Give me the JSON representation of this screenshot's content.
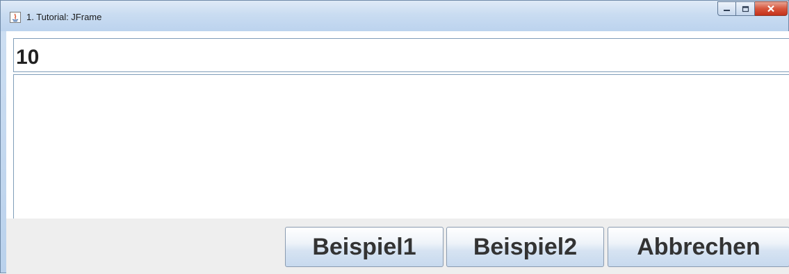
{
  "window": {
    "title": "1. Tutorial: JFrame",
    "app_icon": "java-icon",
    "caption_icons": [
      "minimize-icon",
      "maximize-icon",
      "close-icon"
    ],
    "close_color": "#c4311a"
  },
  "main": {
    "number_field_value": "10",
    "text_area_value": ""
  },
  "buttons": {
    "example1_label": "Beispiel1",
    "example2_label": "Beispiel2",
    "cancel_label": "Abbrechen"
  }
}
